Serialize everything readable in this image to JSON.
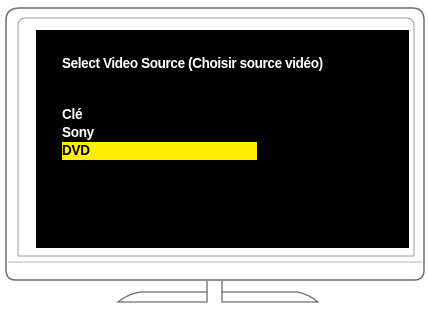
{
  "menu": {
    "title": "Select Video Source (Choisir source vidéo)",
    "items": [
      {
        "label": "Clé",
        "selected": false
      },
      {
        "label": "Sony",
        "selected": false
      },
      {
        "label": "DVD",
        "selected": true
      }
    ],
    "highlight_color": "#ffef00"
  },
  "colors": {
    "screen": "#000000",
    "bezel_stroke": "#6e6e6e",
    "menu_text": "#ffffff",
    "selected_text": "#000000"
  }
}
